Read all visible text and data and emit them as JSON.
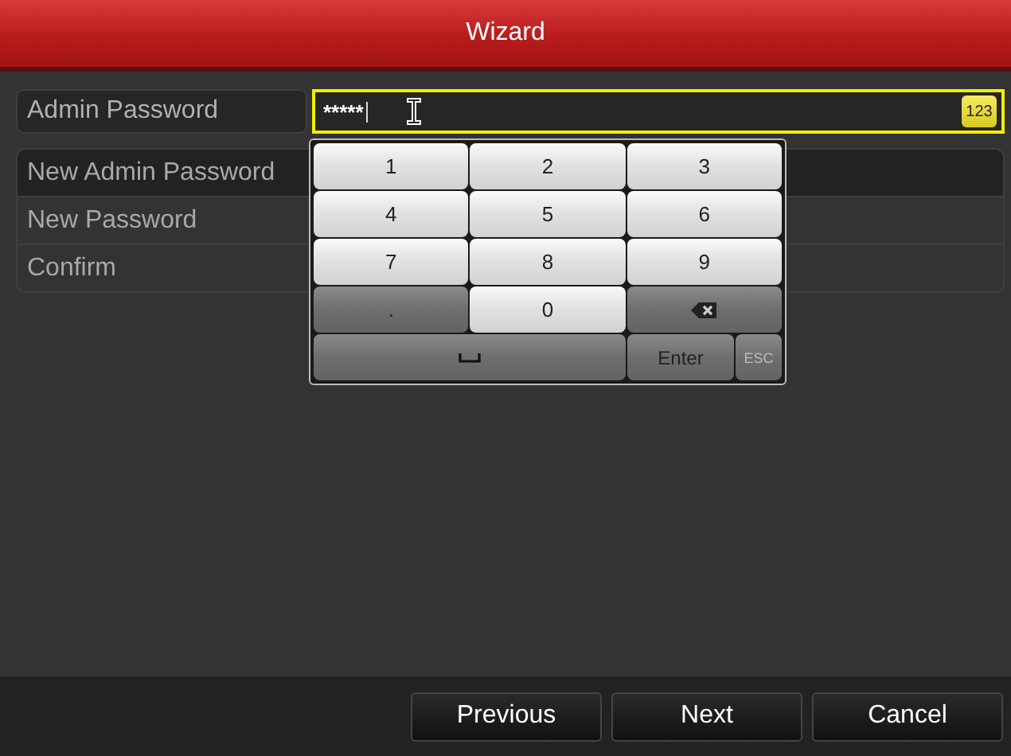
{
  "window": {
    "title": "Wizard"
  },
  "admin_password": {
    "label": "Admin Password",
    "value": "*****",
    "focused": true,
    "mode_badge": "123"
  },
  "password_rows": [
    {
      "label": "New Admin Password",
      "selected": true
    },
    {
      "label": "New Password",
      "selected": false
    },
    {
      "label": "Confirm",
      "selected": false
    }
  ],
  "keypad": {
    "rows": [
      [
        {
          "kind": "digit",
          "label": "1"
        },
        {
          "kind": "digit",
          "label": "2"
        },
        {
          "kind": "digit",
          "label": "3"
        }
      ],
      [
        {
          "kind": "digit",
          "label": "4"
        },
        {
          "kind": "digit",
          "label": "5"
        },
        {
          "kind": "digit",
          "label": "6"
        }
      ],
      [
        {
          "kind": "digit",
          "label": "7"
        },
        {
          "kind": "digit",
          "label": "8"
        },
        {
          "kind": "digit",
          "label": "9"
        }
      ],
      [
        {
          "kind": "dot",
          "label": "."
        },
        {
          "kind": "digit",
          "label": "0"
        },
        {
          "kind": "backspace"
        }
      ],
      [
        {
          "kind": "space"
        },
        {
          "kind": "enter",
          "label": "Enter"
        },
        {
          "kind": "esc",
          "label": "ESC"
        }
      ]
    ]
  },
  "buttons": [
    {
      "label": "Previous"
    },
    {
      "label": "Next"
    },
    {
      "label": "Cancel"
    }
  ]
}
